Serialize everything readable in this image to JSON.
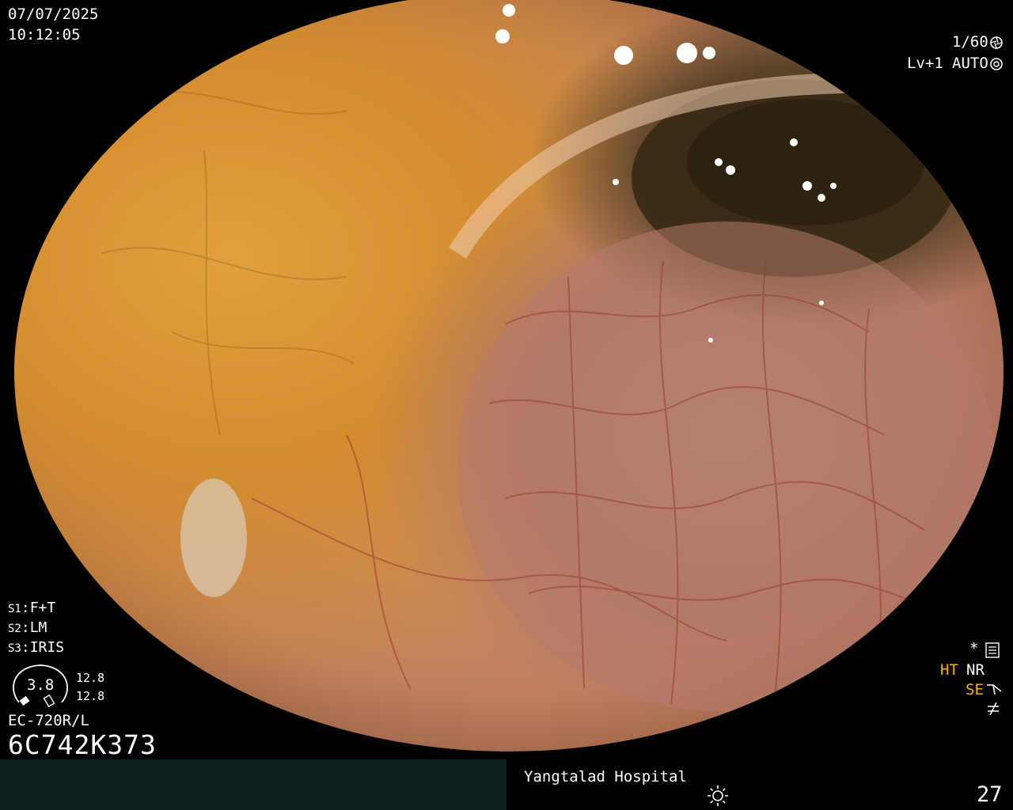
{
  "overlay": {
    "date": "07/07/2025",
    "time": "10:12:05",
    "shutter": "1/60",
    "level": "Lv+1",
    "mode": "AUTO"
  },
  "scope": {
    "s1_key": "S1",
    "s1_val": "F+T",
    "s2_key": "S2",
    "s2_val": "LM",
    "s3_key": "S3",
    "s3_val": "IRIS",
    "dial_value": "3.8",
    "dial_upper": "12.8",
    "dial_lower": "12.8",
    "model": "EC-720R/L",
    "serial": "6C742K373"
  },
  "processing": {
    "ht": "HT",
    "nr": "NR",
    "se": "SE"
  },
  "footer": {
    "hospital": "Yangtalad Hospital",
    "page": "27"
  },
  "colors": {
    "accent_amber": "#ffb000",
    "footer_bg": "#0f2020",
    "mucosa_yellow": "#e0a13e",
    "mucosa_pink": "#c08060",
    "lumen_dark": "#3c2c18"
  },
  "icons": [
    "shutter-icon",
    "auto-iris-icon",
    "settings-list-icon",
    "enhance-icon",
    "no-signal-icon",
    "light-icon"
  ]
}
